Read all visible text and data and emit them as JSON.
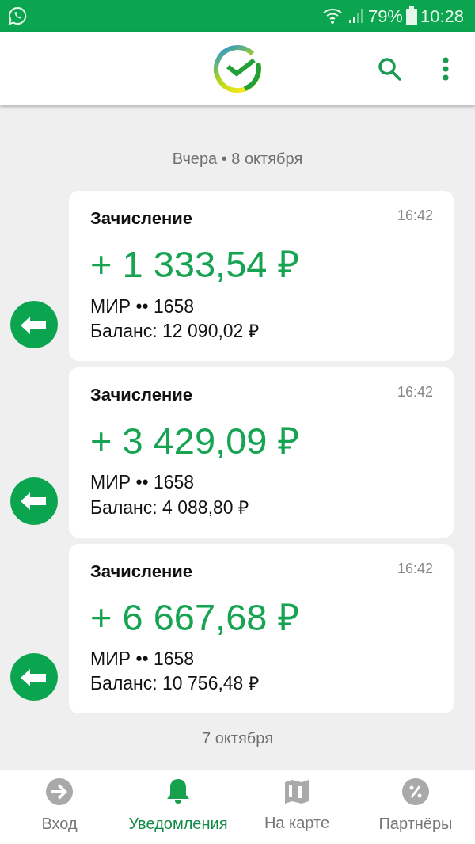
{
  "status_bar": {
    "battery": "79%",
    "time": "10:28"
  },
  "sections": [
    {
      "date": "Вчера • 8 октября",
      "notifications": [
        {
          "title": "Зачисление",
          "time": "16:42",
          "amount": "+ 1 333,54 ₽",
          "card": "МИР •• 1658",
          "balance": "Баланс: 12 090,02 ₽"
        },
        {
          "title": "Зачисление",
          "time": "16:42",
          "amount": "+ 3 429,09 ₽",
          "card": "МИР •• 1658",
          "balance": "Баланс: 4 088,80 ₽"
        },
        {
          "title": "Зачисление",
          "time": "16:42",
          "amount": "+ 6 667,68 ₽",
          "card": "МИР •• 1658",
          "balance": "Баланс: 10 756,48 ₽"
        }
      ]
    },
    {
      "date": "7 октября"
    }
  ],
  "bottom_nav": [
    {
      "kind": "login",
      "label": "Вход",
      "selected": false
    },
    {
      "kind": "bell",
      "label": "Уведомления",
      "selected": true
    },
    {
      "kind": "map",
      "label": "На карте",
      "selected": false
    },
    {
      "kind": "percent",
      "label": "Партнёры",
      "selected": false
    }
  ]
}
